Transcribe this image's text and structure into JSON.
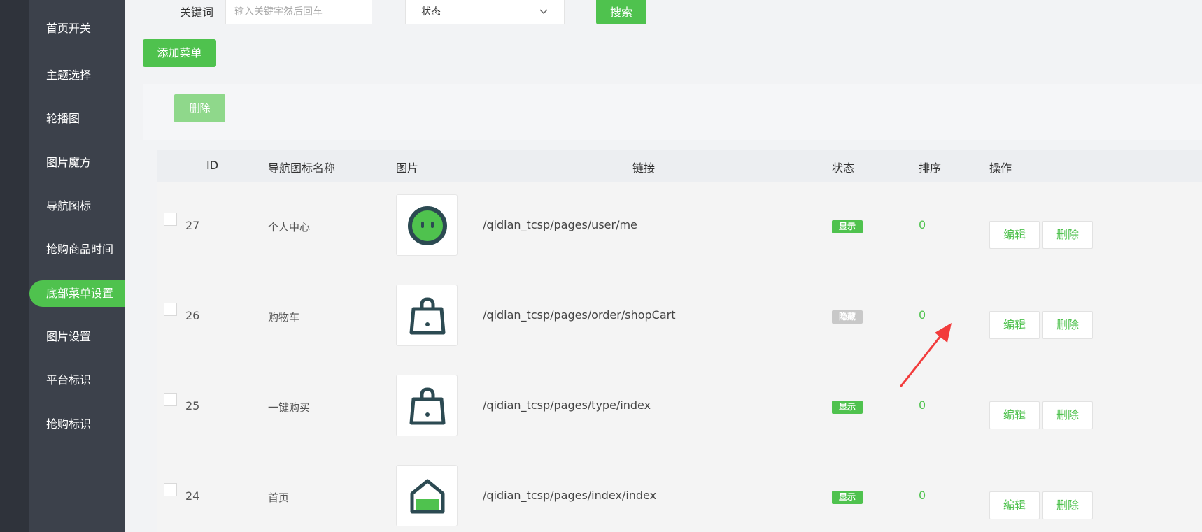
{
  "sidebar": {
    "items": [
      {
        "label": "首页开关"
      },
      {
        "label": "主题选择"
      },
      {
        "label": "轮播图"
      },
      {
        "label": "图片魔方"
      },
      {
        "label": "导航图标"
      },
      {
        "label": "抢购商品时间"
      },
      {
        "label": "底部菜单设置",
        "active": true
      },
      {
        "label": "图片设置"
      },
      {
        "label": "平台标识"
      },
      {
        "label": "抢购标识"
      }
    ]
  },
  "filter": {
    "keyword_label": "关键词",
    "keyword_placeholder": "输入关键字然后回车",
    "status_value": "状态",
    "search_label": "搜索"
  },
  "toolbar": {
    "add_label": "添加菜单",
    "delete_label": "删除"
  },
  "table": {
    "headers": {
      "id": "ID",
      "name": "导航图标名称",
      "image": "图片",
      "link": "链接",
      "status": "状态",
      "sort": "排序",
      "actions": "操作"
    },
    "rows": [
      {
        "id": "27",
        "name": "个人中心",
        "image_icon": "user-face-icon",
        "link": "/qidian_tcsp/pages/user/me",
        "status": "显示",
        "sort": "0",
        "edit": "编辑",
        "delete": "删除"
      },
      {
        "id": "26",
        "name": "购物车",
        "image_icon": "shopping-bag-icon",
        "link": "/qidian_tcsp/pages/order/shopCart",
        "status": "隐藏",
        "sort": "0",
        "edit": "编辑",
        "delete": "删除"
      },
      {
        "id": "25",
        "name": "一键购买",
        "image_icon": "shopping-bag-icon",
        "link": "/qidian_tcsp/pages/type/index",
        "status": "显示",
        "sort": "0",
        "edit": "编辑",
        "delete": "删除"
      },
      {
        "id": "24",
        "name": "首页",
        "image_icon": "home-icon",
        "link": "/qidian_tcsp/pages/index/index",
        "status": "显示",
        "sort": "0",
        "edit": "编辑",
        "delete": "删除"
      }
    ]
  },
  "colors": {
    "accent": "#4fc24e",
    "sidebar": "#3c414b",
    "icon_dark": "#2c4a52",
    "annotation_arrow": "#f23c3c"
  }
}
